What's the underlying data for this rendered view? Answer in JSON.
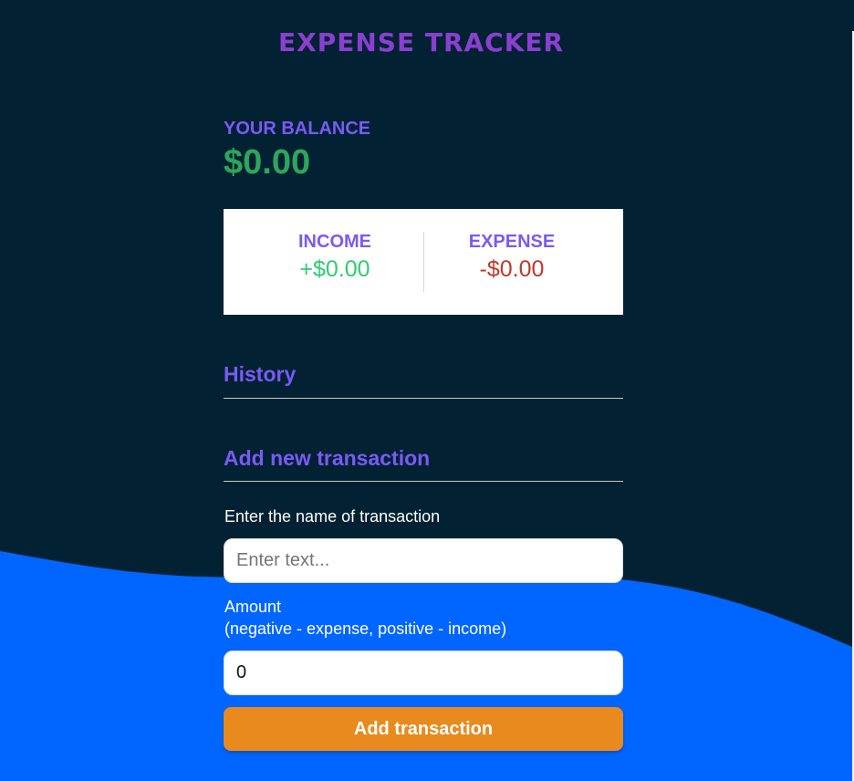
{
  "app": {
    "title": "EXPENSE TRACKER"
  },
  "balance": {
    "label": "YOUR BALANCE",
    "value": "$0.00"
  },
  "summary": {
    "income_label": "INCOME",
    "income_value": "+$0.00",
    "expense_label": "EXPENSE",
    "expense_value": "-$0.00"
  },
  "history": {
    "heading": "History"
  },
  "form": {
    "heading": "Add new transaction",
    "name_label": "Enter the name of transaction",
    "name_placeholder": "Enter text...",
    "name_value": "",
    "amount_label_line1": "Amount",
    "amount_label_line2": "(negative - expense, positive - income)",
    "amount_value": "0",
    "submit_label": "Add transaction"
  },
  "colors": {
    "background": "#022233",
    "wave": "#0066ff",
    "accent": "#7a5af5",
    "title": "#8b3fd0",
    "income": "#2ecc71",
    "expense": "#c0392b",
    "button": "#e88a1e"
  }
}
